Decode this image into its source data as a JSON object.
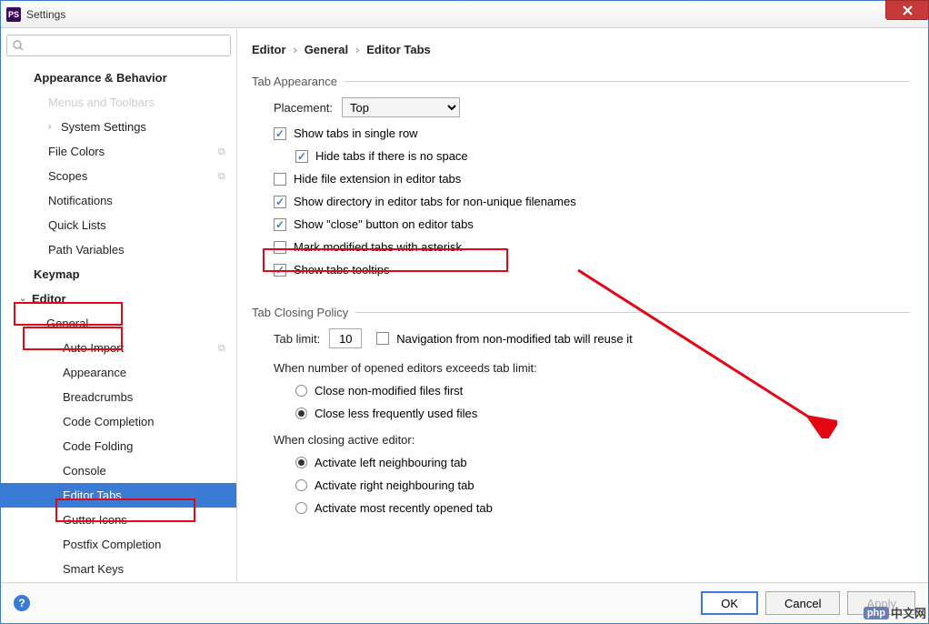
{
  "window": {
    "title": "Settings",
    "logo_text": "PS"
  },
  "search": {
    "placeholder": ""
  },
  "sidebar": {
    "appearance_behavior": "Appearance & Behavior",
    "menus_toolbars": "Menus and Toolbars",
    "system_settings": "System Settings",
    "file_colors": "File Colors",
    "scopes": "Scopes",
    "notifications": "Notifications",
    "quick_lists": "Quick Lists",
    "path_variables": "Path Variables",
    "keymap": "Keymap",
    "editor": "Editor",
    "general": "General",
    "auto_import": "Auto Import",
    "appearance": "Appearance",
    "breadcrumbs": "Breadcrumbs",
    "code_completion": "Code Completion",
    "code_folding": "Code Folding",
    "console": "Console",
    "editor_tabs": "Editor Tabs",
    "gutter_icons": "Gutter Icons",
    "postfix_completion": "Postfix Completion",
    "smart_keys": "Smart Keys"
  },
  "breadcrumb": {
    "p1": "Editor",
    "p2": "General",
    "p3": "Editor Tabs",
    "sep": "›"
  },
  "tab_appearance": {
    "legend": "Tab Appearance",
    "placement_label": "Placement:",
    "placement_value": "Top",
    "single_row": "Show tabs in single row",
    "hide_no_space": "Hide tabs if there is no space",
    "hide_ext": "Hide file extension in editor tabs",
    "show_dir": "Show directory in editor tabs for non-unique filenames",
    "show_close": "Show \"close\" button on editor tabs",
    "mark_modified": "Mark modified tabs with asterisk",
    "tooltips": "Show tabs tooltips"
  },
  "closing_policy": {
    "legend": "Tab Closing Policy",
    "limit_label": "Tab limit:",
    "limit_value": "10",
    "nav_reuse": "Navigation from non-modified tab will reuse it",
    "exceed_label": "When number of opened editors exceeds tab limit:",
    "close_nonmod": "Close non-modified files first",
    "close_freq": "Close less frequently used files",
    "closing_active": "When closing active editor:",
    "act_left": "Activate left neighbouring tab",
    "act_right": "Activate right neighbouring tab",
    "act_recent": "Activate most recently opened tab"
  },
  "buttons": {
    "ok": "OK",
    "cancel": "Cancel",
    "apply": "Apply"
  },
  "watermark": "中文网"
}
